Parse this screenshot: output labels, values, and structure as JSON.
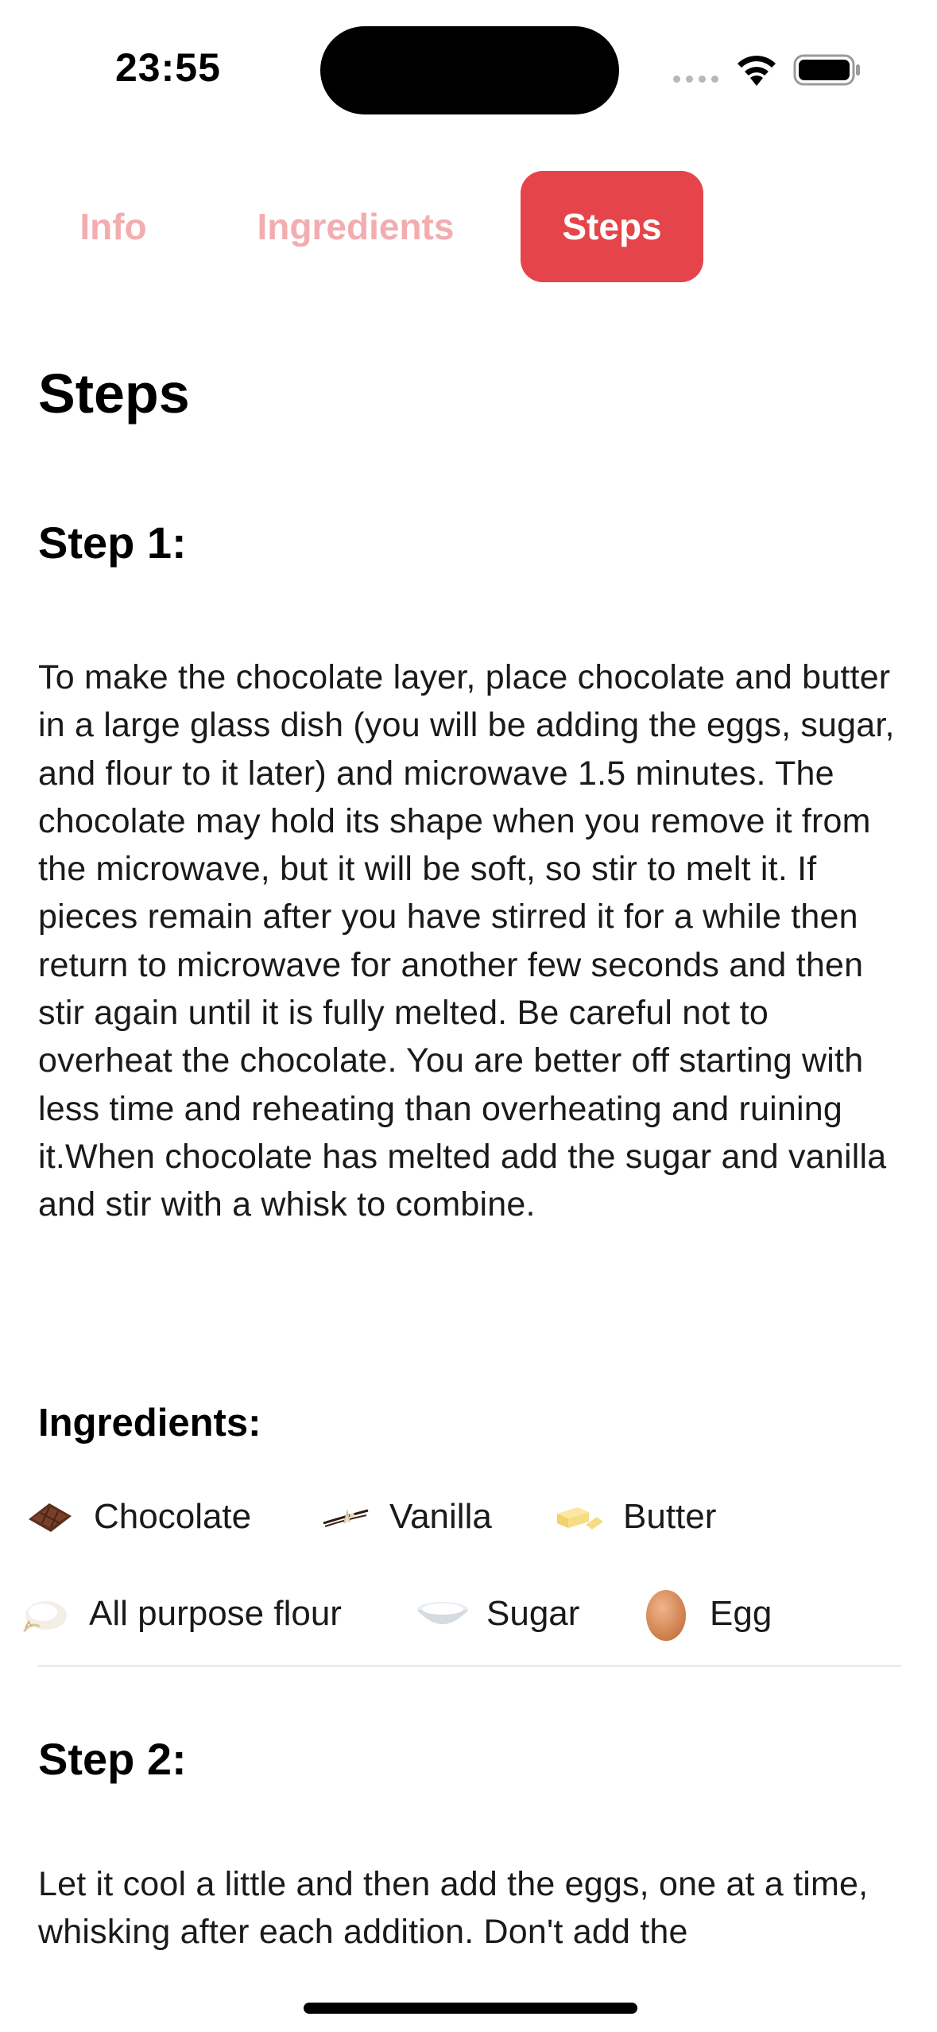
{
  "status_bar": {
    "time": "23:55"
  },
  "tabs": [
    {
      "label": "Info",
      "active": false
    },
    {
      "label": "Ingredients",
      "active": false
    },
    {
      "label": "Steps",
      "active": true
    }
  ],
  "page_title": "Steps",
  "steps": [
    {
      "title": "Step 1:",
      "text": "To make the chocolate layer, place chocolate and butter in a large glass dish (you will be adding the eggs, sugar, and flour to it later) and microwave 1.5 minutes. The chocolate may hold its shape when you remove it from the microwave, but it will be soft, so stir to melt it. If pieces remain after you have stirred it for a while then return to microwave for another few seconds and then stir again until it is fully melted. Be careful not to overheat the chocolate. You are better off starting with less time and reheating than overheating and ruining it.When chocolate has melted add the sugar and vanilla and stir with a whisk to combine.",
      "ingredients_title": "Ingredients:",
      "ingredients": [
        {
          "name": "Chocolate",
          "icon": "chocolate-icon"
        },
        {
          "name": "Vanilla",
          "icon": "vanilla-icon"
        },
        {
          "name": "Butter",
          "icon": "butter-icon"
        },
        {
          "name": "All purpose flour",
          "icon": "flour-icon"
        },
        {
          "name": "Sugar",
          "icon": "sugar-icon"
        },
        {
          "name": "Egg",
          "icon": "egg-icon"
        }
      ]
    },
    {
      "title": "Step 2:",
      "text": "Let it cool a little and then add the eggs, one at a time, whisking after each addition. Don't add the"
    }
  ],
  "colors": {
    "accent": "#e5454a",
    "inactive_tab": "#f2adb0"
  }
}
